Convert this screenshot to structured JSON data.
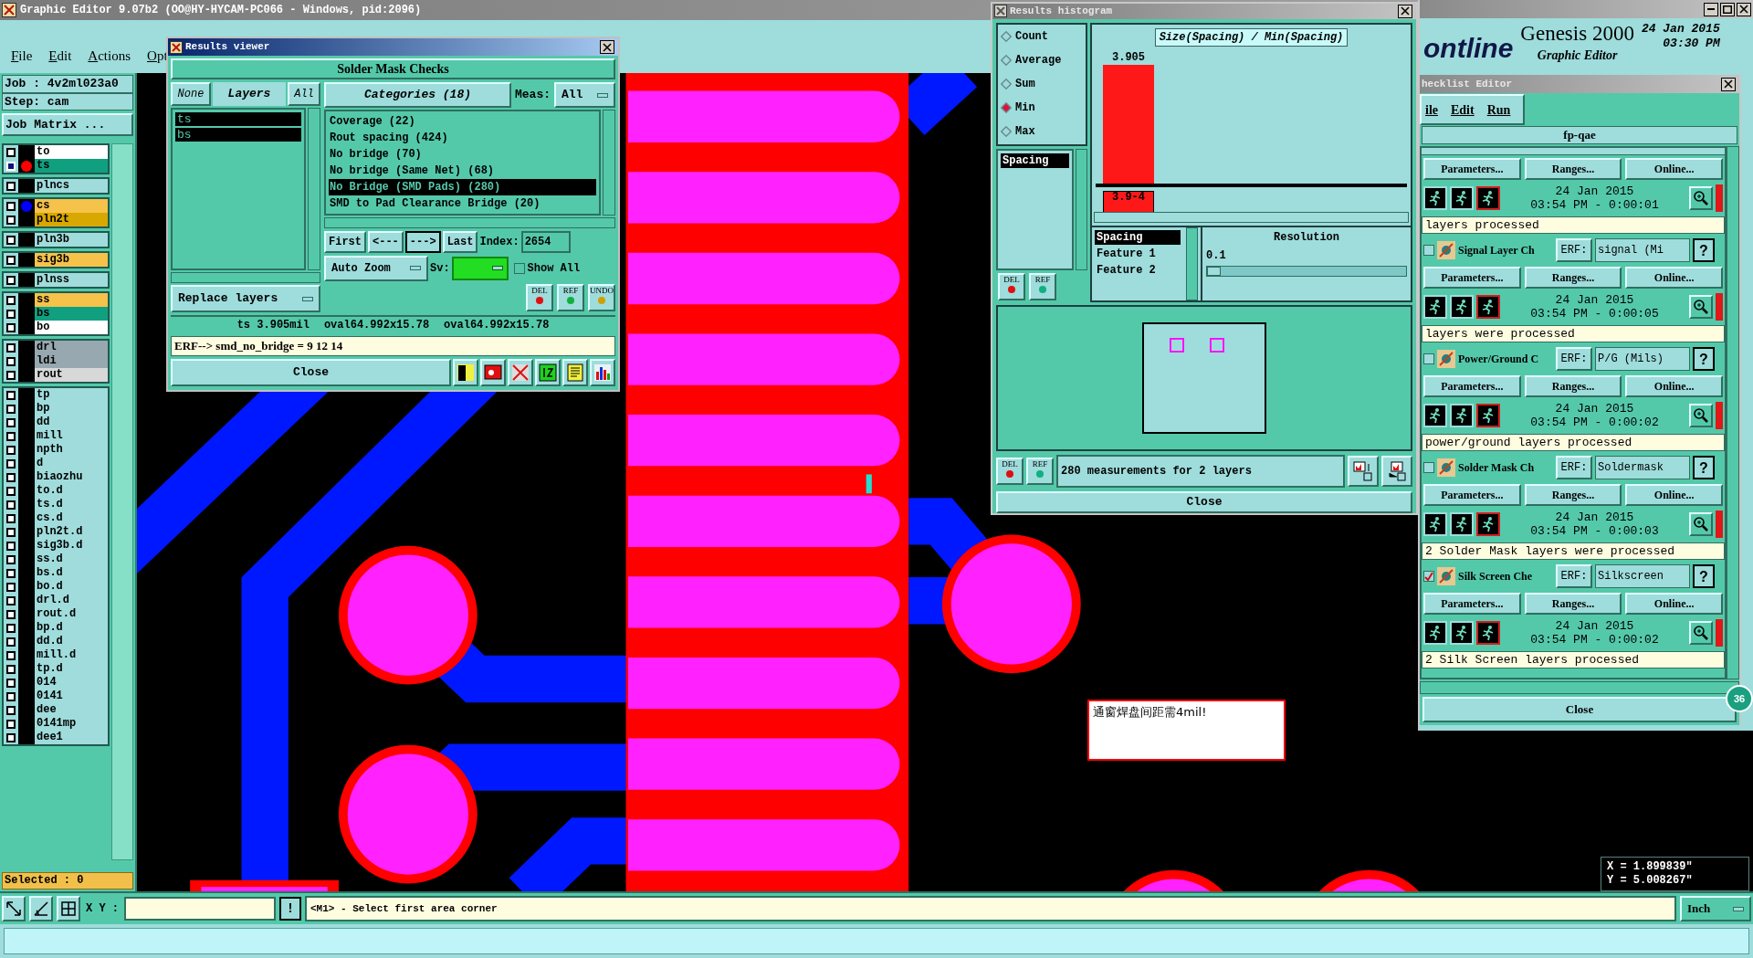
{
  "app_window": {
    "title": "Graphic Editor 9.07b2 (OO@HY-HYCAM-PC066 - Windows, pid:2096)"
  },
  "menu": [
    "File",
    "Edit",
    "Actions",
    "Opt"
  ],
  "job_panel": {
    "job": "Job : 4v2ml023a0",
    "step": "Step: cam",
    "job_matrix_button": "Job Matrix ...",
    "layer_groups": [
      [
        {
          "name": "to",
          "color": "#ffffff",
          "checked": false
        },
        {
          "name": "ts",
          "color": "#10a080",
          "checked": true,
          "dot": {
            "color": "#ff0000"
          }
        }
      ],
      [
        {
          "name": "plncs",
          "color": "#a0dcdc",
          "checked": false
        }
      ],
      [
        {
          "name": "cs",
          "color": "#f5c24a",
          "checked": false,
          "dot": {
            "color": "#0000ff"
          }
        },
        {
          "name": "pln2t",
          "color": "#d8a800",
          "checked": false
        }
      ],
      [
        {
          "name": "pln3b",
          "color": "#a0dcdc",
          "checked": false
        }
      ],
      [
        {
          "name": "sig3b",
          "color": "#f5c24a",
          "checked": false
        }
      ],
      [
        {
          "name": "plnss",
          "color": "#a0dcdc",
          "checked": false
        }
      ],
      [
        {
          "name": "ss",
          "color": "#f5c24a",
          "checked": false
        },
        {
          "name": "bs",
          "color": "#10a080",
          "checked": false
        },
        {
          "name": "bo",
          "color": "#ffffff",
          "checked": false
        }
      ],
      [
        {
          "name": "drl",
          "color": "#98a8b0",
          "checked": false
        },
        {
          "name": "ldi",
          "color": "#98a8b0",
          "checked": false
        },
        {
          "name": "rout",
          "color": "#d8d8d8",
          "checked": false
        }
      ],
      [
        {
          "name": "tp",
          "color": "#a0dcdc",
          "checked": false
        },
        {
          "name": "bp",
          "color": "#a0dcdc",
          "checked": false
        },
        {
          "name": "dd",
          "color": "#a0dcdc",
          "checked": false
        },
        {
          "name": "mill",
          "color": "#a0dcdc",
          "checked": false
        },
        {
          "name": "npth",
          "color": "#a0dcdc",
          "checked": false
        },
        {
          "name": "d",
          "color": "#a0dcdc",
          "checked": false
        },
        {
          "name": "biaozhu",
          "color": "#a0dcdc",
          "checked": false
        },
        {
          "name": "to.d",
          "color": "#a0dcdc",
          "checked": false
        },
        {
          "name": "ts.d",
          "color": "#a0dcdc",
          "checked": false
        },
        {
          "name": "cs.d",
          "color": "#a0dcdc",
          "checked": false
        },
        {
          "name": "pln2t.d",
          "color": "#a0dcdc",
          "checked": false
        },
        {
          "name": "sig3b.d",
          "color": "#a0dcdc",
          "checked": false
        },
        {
          "name": "ss.d",
          "color": "#a0dcdc",
          "checked": false
        },
        {
          "name": "bs.d",
          "color": "#a0dcdc",
          "checked": false
        },
        {
          "name": "bo.d",
          "color": "#a0dcdc",
          "checked": false
        },
        {
          "name": "drl.d",
          "color": "#a0dcdc",
          "checked": false
        },
        {
          "name": "rout.d",
          "color": "#a0dcdc",
          "checked": false
        },
        {
          "name": "bp.d",
          "color": "#a0dcdc",
          "checked": false
        },
        {
          "name": "dd.d",
          "color": "#a0dcdc",
          "checked": false
        },
        {
          "name": "mill.d",
          "color": "#a0dcdc",
          "checked": false
        },
        {
          "name": "tp.d",
          "color": "#a0dcdc",
          "checked": false
        },
        {
          "name": "014",
          "color": "#a0dcdc",
          "checked": false
        },
        {
          "name": "0141",
          "color": "#a0dcdc",
          "checked": false
        },
        {
          "name": "dee",
          "color": "#a0dcdc",
          "checked": false
        },
        {
          "name": "0141mp",
          "color": "#a0dcdc",
          "checked": false
        },
        {
          "name": "dee1",
          "color": "#a0dcdc",
          "checked": false
        }
      ]
    ],
    "selected": "Selected : 0"
  },
  "canvas_note": "通窗焊盘间距需4mil!",
  "coordinates": {
    "x": "X = 1.899839\"",
    "y": "Y = 5.008267\""
  },
  "results_viewer": {
    "title": "Results viewer",
    "heading": "Solder Mask Checks",
    "none_button": "None",
    "layers_label": "Layers",
    "all_button": "All",
    "layers": [
      {
        "name": "ts",
        "selected": true
      },
      {
        "name": "bs",
        "selected": true
      }
    ],
    "categories_button": "Categories (18)",
    "meas_label": "Meas:",
    "meas_value": "All",
    "categories": [
      {
        "label": "Coverage (22)",
        "selected": false
      },
      {
        "label": "Rout spacing (424)",
        "selected": false
      },
      {
        "label": "No bridge (70)",
        "selected": false
      },
      {
        "label": "No bridge (Same Net) (68)",
        "selected": false
      },
      {
        "label": "No Bridge (SMD Pads) (280)",
        "selected": true
      },
      {
        "label": "SMD to Pad Clearance Bridge (20)",
        "selected": false
      }
    ],
    "nav": [
      {
        "label": "First",
        "pressed": false
      },
      {
        "label": "<---",
        "pressed": false
      },
      {
        "label": "--->",
        "pressed": true
      },
      {
        "label": "Last",
        "pressed": false
      }
    ],
    "index_label": "Index:",
    "index_value": "2654",
    "zoom_mode": "Auto Zoom",
    "sv_label": "Sv:",
    "show_all": {
      "label": "Show All",
      "checked": false
    },
    "replace_mode": "Replace layers",
    "tool_buttons": [
      "DEL",
      "REF",
      "UNDO"
    ],
    "measure": [
      "ts 3.905mil",
      "oval64.992x15.78",
      "oval64.992x15.78"
    ],
    "erf_line": "ERF--> smd_no_bridge = 9 12 14",
    "close": "Close"
  },
  "results_histogram": {
    "title": "Results histogram",
    "modes": [
      {
        "label": "Count",
        "selected": false
      },
      {
        "label": "Average",
        "selected": false
      },
      {
        "label": "Sum",
        "selected": false
      },
      {
        "label": "Min",
        "selected": true
      },
      {
        "label": "Max",
        "selected": false
      }
    ],
    "measures": [
      {
        "label": "Spacing",
        "selected": true
      }
    ],
    "top_buttons": [
      "DEL",
      "REF"
    ],
    "histogram": {
      "title": "Size(Spacing) / Min(Spacing)",
      "bins": [
        {
          "value_label": "3.905",
          "range_label": "3.9-4"
        }
      ]
    },
    "fields": [
      {
        "label": "Spacing",
        "selected": true
      },
      {
        "label": "Feature 1",
        "selected": false
      },
      {
        "label": "Feature 2",
        "selected": false
      }
    ],
    "resolution_label": "Resolution",
    "resolution_value": "0.1",
    "resolution": {
      "level": 0.07
    },
    "bottom_buttons": [
      "DEL",
      "REF"
    ],
    "summary": "280 measurements for 2 layers",
    "close": "Close"
  },
  "genesis": {
    "logo": "ontline",
    "title": "Genesis 2000",
    "subtitle": "Graphic Editor",
    "date": "24 Jan 2015",
    "time": "03:30 PM",
    "badge": "36"
  },
  "checklist_editor": {
    "title": "hecklist Editor",
    "menu": [
      "ile",
      "Edit",
      "Run"
    ],
    "checklist": "fp-qae",
    "checks": [
      {
        "buttons": [
          "Parameters...",
          "Ranges...",
          "Online..."
        ],
        "date": "24 Jan 2015",
        "time": "03:54 PM - 0:00:01",
        "message": "layers processed"
      },
      {
        "name": "Signal Layer Ch",
        "checked": false,
        "erf_label": "ERF:",
        "erf": "signal (Mi",
        "help": "?",
        "buttons": [
          "Parameters...",
          "Ranges...",
          "Online..."
        ],
        "date": "24 Jan 2015",
        "time": "03:54 PM - 0:00:05",
        "message": "layers were processed"
      },
      {
        "name": "Power/Ground C",
        "checked": false,
        "erf_label": "ERF:",
        "erf": "P/G (Mils)",
        "help": "?",
        "buttons": [
          "Parameters...",
          "Ranges...",
          "Online..."
        ],
        "date": "24 Jan 2015",
        "time": "03:54 PM - 0:00:02",
        "message": "power/ground layers processed"
      },
      {
        "name": "Solder Mask Ch",
        "checked": false,
        "erf_label": "ERF:",
        "erf": "Soldermask",
        "help": "?",
        "buttons": [
          "Parameters...",
          "Ranges...",
          "Online..."
        ],
        "date": "24 Jan 2015",
        "time": "03:54 PM - 0:00:03",
        "message": "2 Solder Mask layers were processed"
      },
      {
        "name": "Silk Screen Che",
        "checked": true,
        "erf_label": "ERF:",
        "erf": "Silkscreen",
        "help": "?",
        "buttons": [
          "Parameters...",
          "Ranges...",
          "Online..."
        ],
        "date": "24 Jan 2015",
        "time": "03:54 PM - 0:00:02",
        "message": "2 Silk Screen layers processed"
      }
    ],
    "close": "Close"
  },
  "command_bar": {
    "xy_label": "X Y :",
    "bang": "!",
    "message": "<M1> - Select first area corner",
    "units": "Inch"
  }
}
